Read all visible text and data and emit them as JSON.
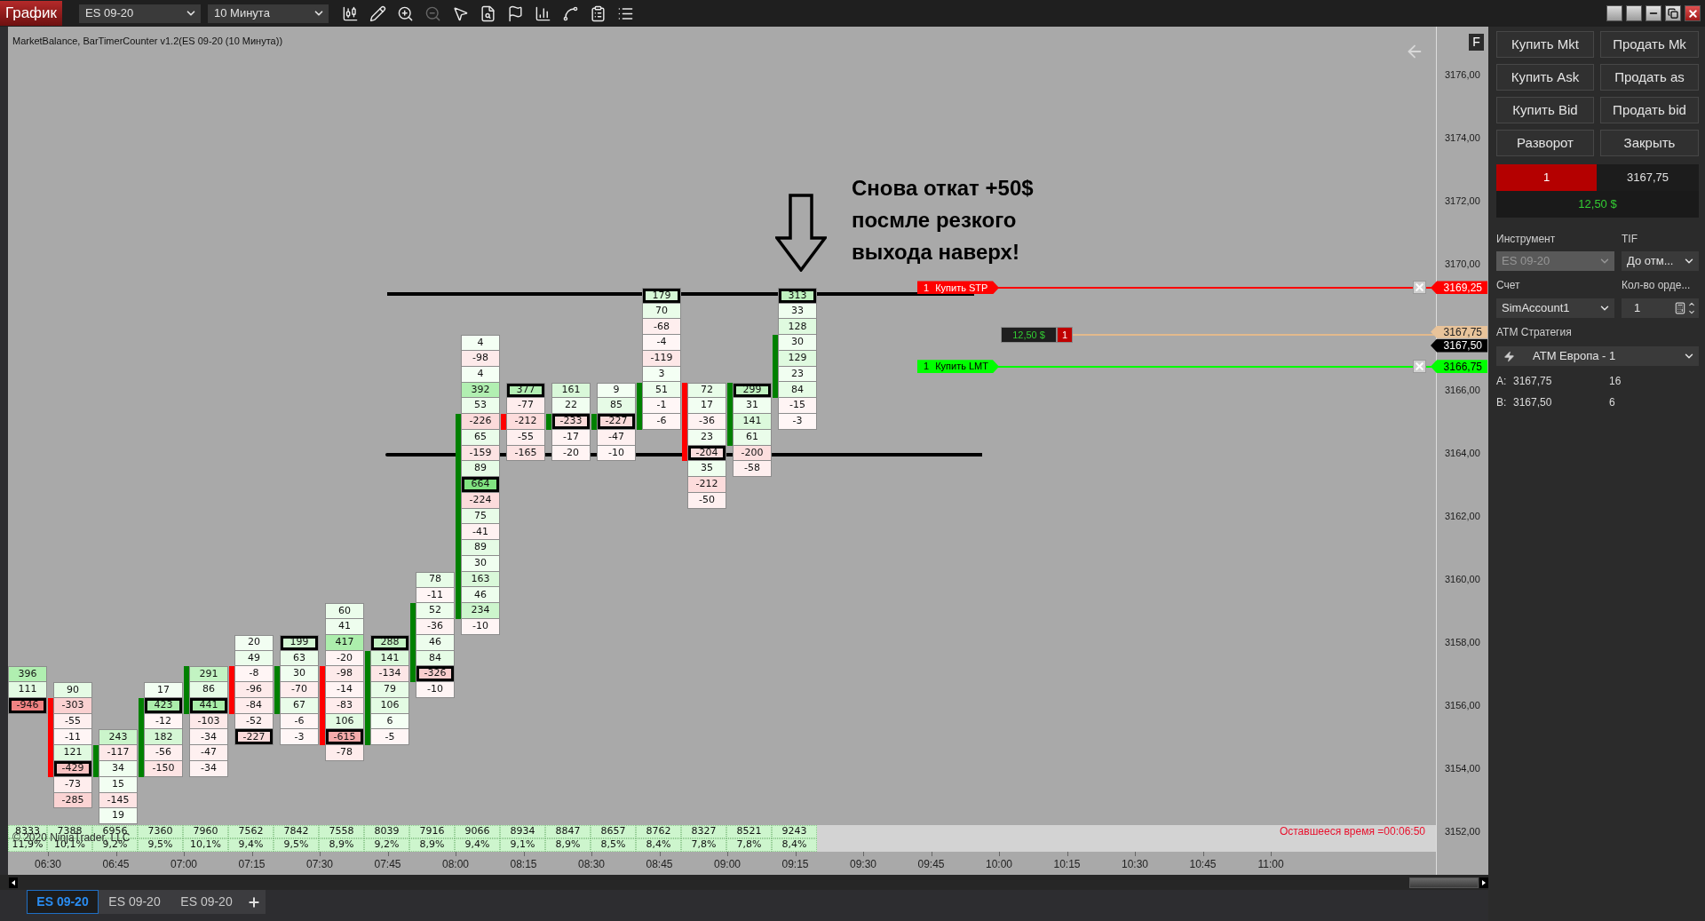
{
  "toolbar": {
    "title": "График",
    "instrument": "ES 09-20",
    "interval": "10 Минута",
    "tools": [
      {
        "disabled": false
      },
      {
        "disabled": false
      },
      {
        "disabled": false
      },
      {
        "disabled": true
      },
      {
        "disabled": false
      },
      {
        "disabled": false
      },
      {
        "disabled": false
      },
      {
        "disabled": false
      },
      {
        "disabled": false
      },
      {
        "disabled": false
      },
      {
        "disabled": false
      }
    ]
  },
  "chart": {
    "header": "MarketBalance, BarTimerCounter v1.2(ES 09-20 (10 Минута))",
    "flag": "F",
    "annotation": "Снова откат +50$\nпосмле резкого\nвыхода наверх!",
    "bars": [
      {
        "cells": [
          {
            "value": "396",
            "outlined": false
          },
          {
            "value": "111",
            "outlined": false
          },
          {
            "value": "-946",
            "outlined": true
          }
        ],
        "volume": "8333",
        "share": "11,9%"
      },
      {
        "rising": false,
        "cells": [
          {
            "value": "90",
            "outlined": false
          },
          {
            "value": "-303",
            "outlined": false
          },
          {
            "value": "-55",
            "outlined": false
          },
          {
            "value": "-11",
            "outlined": false
          },
          {
            "value": "121",
            "outlined": false
          },
          {
            "value": "-429",
            "outlined": true
          },
          {
            "value": "-73",
            "outlined": false
          },
          {
            "value": "-285",
            "outlined": false
          }
        ],
        "volume": "7388",
        "share": "10,1%"
      },
      {
        "rising": true,
        "cells": [
          {
            "value": "243",
            "outlined": false
          },
          {
            "value": "-117",
            "outlined": false
          },
          {
            "value": "34",
            "outlined": false
          },
          {
            "value": "15",
            "outlined": false
          },
          {
            "value": "-145",
            "outlined": false
          },
          {
            "value": "19",
            "outlined": false
          }
        ],
        "volume": "6956",
        "share": "9,2%"
      },
      {
        "rising": true,
        "cells": [
          {
            "value": "17",
            "outlined": false
          },
          {
            "value": "423",
            "outlined": true
          },
          {
            "value": "-12",
            "outlined": false
          },
          {
            "value": "182",
            "outlined": false
          },
          {
            "value": "-56",
            "outlined": false
          },
          {
            "value": "-150",
            "outlined": false
          }
        ],
        "volume": "7360",
        "share": "9,5%"
      },
      {
        "rising": true,
        "cells": [
          {
            "value": "291",
            "outlined": false
          },
          {
            "value": "86",
            "outlined": false
          },
          {
            "value": "441",
            "outlined": true
          },
          {
            "value": "-103",
            "outlined": false
          },
          {
            "value": "-34",
            "outlined": false
          },
          {
            "value": "-47",
            "outlined": false
          },
          {
            "value": "-34",
            "outlined": false
          }
        ],
        "volume": "7960",
        "share": "10,1%"
      },
      {
        "rising": false,
        "cells": [
          {
            "value": "20",
            "outlined": false
          },
          {
            "value": "49",
            "outlined": false
          },
          {
            "value": "-8",
            "outlined": false
          },
          {
            "value": "-96",
            "outlined": false
          },
          {
            "value": "-84",
            "outlined": false
          },
          {
            "value": "-52",
            "outlined": false
          },
          {
            "value": "-227",
            "outlined": true
          }
        ],
        "volume": "7562",
        "share": "9,4%"
      },
      {
        "rising": true,
        "cells": [
          {
            "value": "199",
            "outlined": true
          },
          {
            "value": "63",
            "outlined": false
          },
          {
            "value": "30",
            "outlined": false
          },
          {
            "value": "-70",
            "outlined": false
          },
          {
            "value": "67",
            "outlined": false
          },
          {
            "value": "-6",
            "outlined": false
          },
          {
            "value": "-3",
            "outlined": false
          }
        ],
        "volume": "7842",
        "share": "9,5%"
      },
      {
        "rising": false,
        "cells": [
          {
            "value": "60",
            "outlined": false
          },
          {
            "value": "41",
            "outlined": false
          },
          {
            "value": "417",
            "outlined": false
          },
          {
            "value": "-20",
            "outlined": false
          },
          {
            "value": "-98",
            "outlined": false
          },
          {
            "value": "-14",
            "outlined": false
          },
          {
            "value": "-83",
            "outlined": false
          },
          {
            "value": "106",
            "outlined": false
          },
          {
            "value": "-615",
            "outlined": true
          },
          {
            "value": "-78",
            "outlined": false
          }
        ],
        "volume": "7558",
        "share": "8,9%"
      },
      {
        "rising": true,
        "cells": [
          {
            "value": "288",
            "outlined": true
          },
          {
            "value": "141",
            "outlined": false
          },
          {
            "value": "-134",
            "outlined": false
          },
          {
            "value": "79",
            "outlined": false
          },
          {
            "value": "106",
            "outlined": false
          },
          {
            "value": "6",
            "outlined": false
          },
          {
            "value": "-5",
            "outlined": false
          }
        ],
        "volume": "8039",
        "share": "9,2%"
      },
      {
        "rising": true,
        "cells": [
          {
            "value": "78",
            "outlined": false
          },
          {
            "value": "-11",
            "outlined": false
          },
          {
            "value": "52",
            "outlined": false
          },
          {
            "value": "-36",
            "outlined": false
          },
          {
            "value": "46",
            "outlined": false
          },
          {
            "value": "84",
            "outlined": false
          },
          {
            "value": "-326",
            "outlined": true
          },
          {
            "value": "-10",
            "outlined": false
          }
        ],
        "volume": "7916",
        "share": "8,9%"
      },
      {
        "rising": true,
        "cells": [
          {
            "value": "4",
            "outlined": false
          },
          {
            "value": "-98",
            "outlined": false
          },
          {
            "value": "4",
            "outlined": false
          },
          {
            "value": "392",
            "outlined": false
          },
          {
            "value": "53",
            "outlined": false
          },
          {
            "value": "-226",
            "outlined": false
          },
          {
            "value": "65",
            "outlined": false
          },
          {
            "value": "-159",
            "outlined": false
          },
          {
            "value": "89",
            "outlined": false
          },
          {
            "value": "664",
            "outlined": true
          },
          {
            "value": "-224",
            "outlined": false
          },
          {
            "value": "75",
            "outlined": false
          },
          {
            "value": "-41",
            "outlined": false
          },
          {
            "value": "89",
            "outlined": false
          },
          {
            "value": "30",
            "outlined": false
          },
          {
            "value": "163",
            "outlined": false
          },
          {
            "value": "46",
            "outlined": false
          },
          {
            "value": "234",
            "outlined": false
          },
          {
            "value": "-10",
            "outlined": false
          }
        ],
        "volume": "9066",
        "share": "9,4%"
      },
      {
        "rising": false,
        "cells": [
          {
            "value": "377",
            "outlined": true
          },
          {
            "value": "-77",
            "outlined": false
          },
          {
            "value": "-212",
            "outlined": false
          },
          {
            "value": "-55",
            "outlined": false
          },
          {
            "value": "-165",
            "outlined": false
          }
        ],
        "volume": "8934",
        "share": "9,1%"
      },
      {
        "rising": true,
        "cells": [
          {
            "value": "161",
            "outlined": false
          },
          {
            "value": "22",
            "outlined": false
          },
          {
            "value": "-233",
            "outlined": true
          },
          {
            "value": "-17",
            "outlined": false
          },
          {
            "value": "-20",
            "outlined": false
          }
        ],
        "volume": "8847",
        "share": "8,9%"
      },
      {
        "rising": true,
        "cells": [
          {
            "value": "9",
            "outlined": false
          },
          {
            "value": "85",
            "outlined": false
          },
          {
            "value": "-227",
            "outlined": true
          },
          {
            "value": "-47",
            "outlined": false
          },
          {
            "value": "-10",
            "outlined": false
          }
        ],
        "volume": "8657",
        "share": "8,5%"
      },
      {
        "rising": true,
        "cells": [
          {
            "value": "179",
            "outlined": true
          },
          {
            "value": "70",
            "outlined": false
          },
          {
            "value": "-68",
            "outlined": false
          },
          {
            "value": "-4",
            "outlined": false
          },
          {
            "value": "-119",
            "outlined": false
          },
          {
            "value": "3",
            "outlined": false
          },
          {
            "value": "51",
            "outlined": false
          },
          {
            "value": "-1",
            "outlined": false
          },
          {
            "value": "-6",
            "outlined": false
          }
        ],
        "volume": "8762",
        "share": "8,4%"
      },
      {
        "rising": false,
        "cells": [
          {
            "value": "72",
            "outlined": false
          },
          {
            "value": "17",
            "outlined": false
          },
          {
            "value": "-36",
            "outlined": false
          },
          {
            "value": "23",
            "outlined": false
          },
          {
            "value": "-204",
            "outlined": true
          },
          {
            "value": "35",
            "outlined": false
          },
          {
            "value": "-212",
            "outlined": false
          },
          {
            "value": "-50",
            "outlined": false
          }
        ],
        "volume": "8327",
        "share": "7,8%"
      },
      {
        "rising": true,
        "cells": [
          {
            "value": "299",
            "outlined": true
          },
          {
            "value": "31",
            "outlined": false
          },
          {
            "value": "141",
            "outlined": false
          },
          {
            "value": "61",
            "outlined": false
          },
          {
            "value": "-200",
            "outlined": false
          },
          {
            "value": "-58",
            "outlined": false
          }
        ],
        "volume": "8521",
        "share": "7,8%"
      },
      {
        "rising": true,
        "cells": [
          {
            "value": "313",
            "outlined": true
          },
          {
            "value": "33",
            "outlined": false
          },
          {
            "value": "128",
            "outlined": false
          },
          {
            "value": "30",
            "outlined": false
          },
          {
            "value": "129",
            "outlined": false
          },
          {
            "value": "23",
            "outlined": false
          },
          {
            "value": "84",
            "outlined": false
          },
          {
            "value": "-15",
            "outlined": false
          },
          {
            "value": "-3",
            "outlined": false
          }
        ],
        "volume": "9243",
        "share": "8,4%"
      }
    ],
    "orders": [
      {
        "kind": "stop",
        "quantity": "1",
        "label": "Купить STP",
        "price": "3169,25"
      },
      {
        "kind": "limit",
        "quantity": "1",
        "label": "Купить LMT",
        "price": "3166,75"
      }
    ],
    "position": {
      "pnl": "12,50 $",
      "quantity": "1",
      "price": "3167,75"
    },
    "last_price": "3167,50",
    "price_axis": [
      "3176,00",
      "3174,00",
      "3172,00",
      "3170,00",
      "3166,00",
      "3164,00",
      "3162,00",
      "3160,00",
      "3158,00",
      "3156,00",
      "3154,00",
      "3152,00"
    ],
    "time_axis": [
      "06:30",
      "06:45",
      "07:00",
      "07:15",
      "07:30",
      "07:45",
      "08:00",
      "08:15",
      "08:30",
      "08:45",
      "09:00",
      "09:15",
      "09:30",
      "09:45",
      "10:00",
      "10:15",
      "10:30",
      "10:45",
      "11:00"
    ],
    "remaining_time": "Оставшееся время =00:06:50",
    "copyright": "© 2020 NinjaTrader, LLC"
  },
  "tabs": [
    {
      "label": "ES 09-20",
      "selected": true
    },
    {
      "label": "ES 09-20",
      "selected": false
    },
    {
      "label": "ES 09-20",
      "selected": false
    }
  ],
  "order_panel": {
    "buttons": [
      "Купить Mkt",
      "Продать Mk",
      "Купить Ask",
      "Продать as",
      "Купить Bid",
      "Продать bid",
      "Разворот",
      "Закрыть"
    ],
    "position": {
      "quantity": "1",
      "price": "3167,75",
      "pnl": "12,50 $"
    },
    "instrument": {
      "label": "Инструмент",
      "value": "ES 09-20",
      "disabled": true
    },
    "tif": {
      "label": "TIF",
      "value": "До отм..."
    },
    "account": {
      "label": "Счет",
      "value": "SimAccount1"
    },
    "order_quantity": {
      "label": "Кол-во орде...",
      "value": "1"
    },
    "atm_strategy": {
      "label": "ATM Стратегия",
      "value": "ATM Европа - 1"
    },
    "quotes": [
      {
        "side": "A:",
        "price": "3167,75",
        "size": "16"
      },
      {
        "side": "B:",
        "price": "3167,50",
        "size": "6"
      }
    ]
  }
}
